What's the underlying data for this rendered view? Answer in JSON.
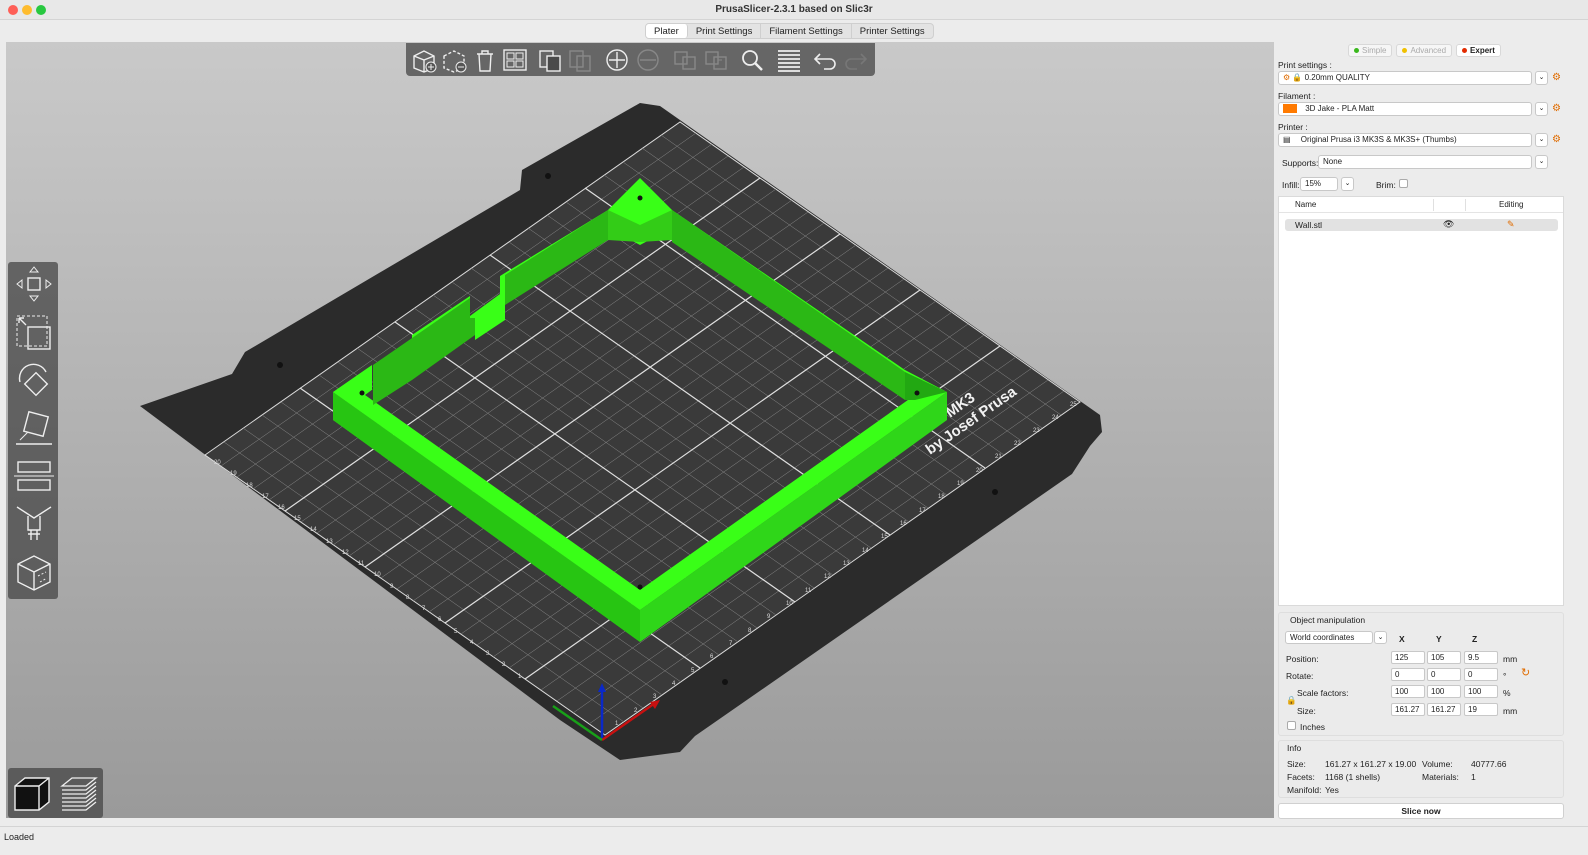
{
  "window": {
    "title": "PrusaSlicer-2.3.1 based on Slic3r"
  },
  "tabs": [
    {
      "label": "Plater",
      "active": true
    },
    {
      "label": "Print Settings"
    },
    {
      "label": "Filament Settings"
    },
    {
      "label": "Printer Settings"
    }
  ],
  "bed": {
    "logo_line1": "MK3",
    "logo_line2": "by Josef Prusa",
    "bottom_ticks": [
      "25",
      "24",
      "23",
      "22",
      "21",
      "20",
      "19",
      "18",
      "17",
      "16",
      "15",
      "14",
      "13",
      "12",
      "11",
      "10",
      "9",
      "8",
      "7",
      "6",
      "5",
      "4",
      "3",
      "2",
      "1"
    ],
    "left_ticks": [
      "20",
      "19",
      "18",
      "17",
      "16",
      "15",
      "14",
      "13",
      "12",
      "11",
      "10",
      "9",
      "8",
      "7",
      "6",
      "5",
      "4",
      "3",
      "2",
      "1"
    ]
  },
  "mode": {
    "simple": "Simple",
    "advanced": "Advanced",
    "expert": "Expert",
    "colors": {
      "simple": "#3ab81c",
      "advanced": "#f0c000",
      "expert": "#e22b00"
    }
  },
  "settings": {
    "print_label": "Print settings :",
    "print_value": "0.20mm QUALITY",
    "filament_label": "Filament :",
    "filament_value": "3D Jake - PLA Matt",
    "filament_color": "#ff7a00",
    "printer_label": "Printer :",
    "printer_value": "Original Prusa i3 MK3S & MK3S+  (Thumbs)",
    "supports_label": "Supports:",
    "supports_value": "None",
    "infill_label": "Infill:",
    "infill_value": "15%",
    "brim_label": "Brim:"
  },
  "objects": {
    "col_name": "Name",
    "col_editing": "Editing",
    "rows": [
      {
        "name": "Wall.stl"
      }
    ]
  },
  "manip": {
    "title": "Object manipulation",
    "coords": "World coordinates",
    "axis_x": "X",
    "axis_y": "Y",
    "axis_z": "Z",
    "position_label": "Position:",
    "position": [
      "125",
      "105",
      "9.5"
    ],
    "position_unit": "mm",
    "rotate_label": "Rotate:",
    "rotate": [
      "0",
      "0",
      "0"
    ],
    "rotate_unit": "°",
    "scale_label": "Scale factors:",
    "scale": [
      "100",
      "100",
      "100"
    ],
    "scale_unit": "%",
    "size_label": "Size:",
    "size": [
      "161.27",
      "161.27",
      "19"
    ],
    "size_unit": "mm",
    "inches_label": "Inches"
  },
  "info": {
    "title": "Info",
    "size_label": "Size:",
    "size_value": "161.27 x 161.27 x 19.00",
    "volume_label": "Volume:",
    "volume_value": "40777.66",
    "facets_label": "Facets:",
    "facets_value": "1168 (1 shells)",
    "materials_label": "Materials:",
    "materials_value": "1",
    "manifold_label": "Manifold:",
    "manifold_value": "Yes"
  },
  "slice_button": "Slice now",
  "status": "Loaded",
  "icons": {
    "toolbar": [
      "add-icon",
      "delete-icon",
      "delete-all-icon",
      "arrange-icon",
      "copy-icon",
      "paste-icon",
      "add-instance-icon",
      "remove-instance-icon",
      "split-objects-icon",
      "split-parts-icon",
      "search-icon",
      "layers-icon",
      "undo-icon",
      "redo-icon"
    ],
    "gizmos": [
      "move-icon",
      "scale-icon",
      "rotate-icon",
      "place-on-face-icon",
      "cut-icon",
      "paint-supports-icon",
      "seam-icon"
    ]
  }
}
